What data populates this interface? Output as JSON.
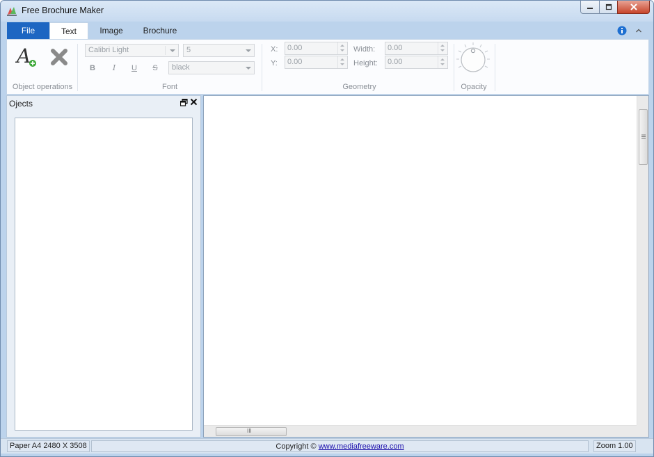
{
  "window": {
    "title": "Free Brochure Maker",
    "icon": "brochure-app-icon",
    "controls": {
      "minimize_icon": "minimize-icon",
      "maximize_icon": "maximize-icon",
      "close_icon": "close-icon"
    }
  },
  "ribbon": {
    "tabs": [
      {
        "label": "File",
        "active": false
      },
      {
        "label": "Text",
        "active": true
      },
      {
        "label": "Image",
        "active": false
      },
      {
        "label": "Brochure",
        "active": false
      }
    ],
    "groups": {
      "object_operations": {
        "label": "Object operations",
        "add_icon": "add-text-icon",
        "delete_icon": "delete-icon"
      },
      "font": {
        "label": "Font",
        "family": "Calibri Light",
        "size": "5",
        "color": "black",
        "bold": "B",
        "italic": "I",
        "underline": "U",
        "strike": "S"
      },
      "geometry": {
        "label": "Geometry",
        "x_label": "X:",
        "x_value": "0.00",
        "y_label": "Y:",
        "y_value": "0.00",
        "width_label": "Width:",
        "width_value": "0.00",
        "height_label": "Height:",
        "height_value": "0.00"
      },
      "opacity": {
        "label": "Opacity",
        "knob_icon": "opacity-knob-icon"
      }
    },
    "info_icon": "info-icon",
    "collapse_icon": "chevron-up-icon"
  },
  "objects_panel": {
    "title": "Ojects",
    "items": []
  },
  "canvas": {
    "scroll_grip": "III"
  },
  "status": {
    "paper": "Paper A4 2480 X 3508",
    "copyright_prefix": "Copyright ©",
    "copyright_link": "www.mediafreeware.com",
    "zoom": "Zoom 1.00"
  },
  "colors": {
    "accent": "#1d66c2",
    "frame": "#bcd3ec",
    "close_button": "#c7452b"
  }
}
